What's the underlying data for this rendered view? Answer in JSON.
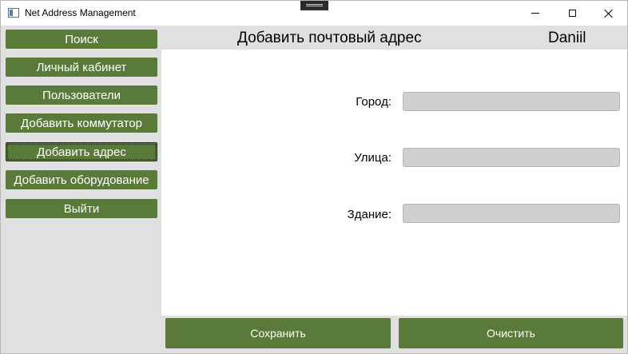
{
  "window": {
    "title": "Net Address Management"
  },
  "sidebar": {
    "items": [
      {
        "label": "Поиск"
      },
      {
        "label": "Личный кабинет"
      },
      {
        "label": "Пользователи"
      },
      {
        "label": "Добавить коммутатор"
      },
      {
        "label": "Добавить адрес",
        "active": true
      },
      {
        "label": "Добавить оборудование"
      },
      {
        "label": "Выйти"
      }
    ]
  },
  "header": {
    "title": "Добавить почтовый адрес",
    "username": "Daniil"
  },
  "form": {
    "fields": [
      {
        "label": "Город:",
        "value": ""
      },
      {
        "label": "Улица:",
        "value": ""
      },
      {
        "label": "Здание:",
        "value": ""
      }
    ]
  },
  "actions": {
    "save_label": "Сохранить",
    "clear_label": "Очистить"
  },
  "colors": {
    "accent_green": "#5a7a3a",
    "panel_gray": "#e0e0e0",
    "input_gray": "#cfcfcf"
  }
}
